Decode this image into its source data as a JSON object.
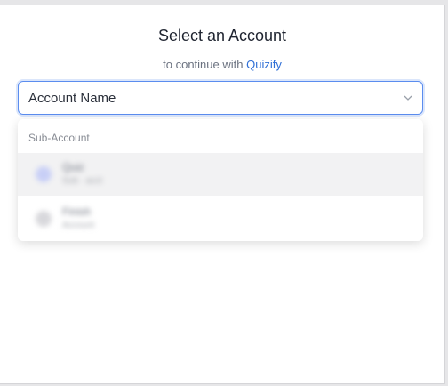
{
  "dialog": {
    "title": "Select an Account",
    "subtitle_prefix": "to continue with",
    "brand": "Quizify",
    "brand_color": "#2f6fd6"
  },
  "account_select": {
    "value": "Account Name",
    "icon": "chevron-down-icon"
  },
  "dropdown": {
    "group_label": "Sub-Account",
    "options": [
      {
        "name": "Quiz",
        "detail": "Sub · acct"
      },
      {
        "name": "Finish",
        "detail": "Account"
      }
    ]
  }
}
